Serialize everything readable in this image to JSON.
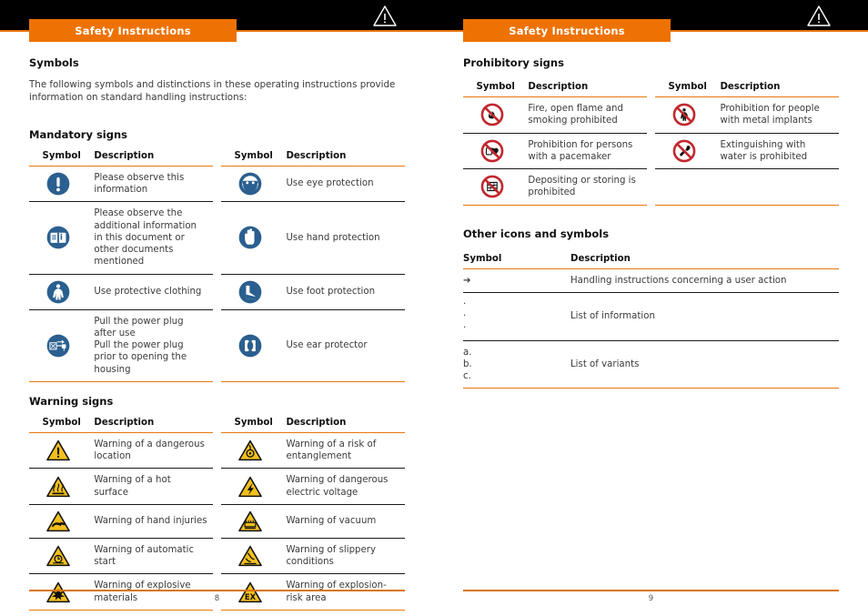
{
  "colors": {
    "accent_orange": "#ee7203",
    "rule_orange": "#e8760c",
    "header_black": "#000000",
    "mandatory_blue": "#2a5f8f",
    "warning_yellow": "#f2c01e",
    "prohibition_red": "#c1272d",
    "body_text": "#3b3b3b"
  },
  "left_page": {
    "header": {
      "tab_label": "Safety Instructions",
      "warning_icon": "warning-triangle-icon"
    },
    "symbols_heading": "Symbols",
    "intro_text": "The following symbols and distinctions in these operating instructions provide information on standard handling instructions:",
    "mandatory": {
      "heading": "Mandatory signs",
      "columns": [
        "Symbol",
        "Description",
        "Symbol",
        "Description"
      ],
      "rows": [
        {
          "left_icon": "mandatory-information-icon",
          "left_desc": "Please observe this information",
          "right_icon": "eye-protection-icon",
          "right_desc": "Use eye protection"
        },
        {
          "left_icon": "refer-to-manual-icon",
          "left_desc": "Please observe the additional information in this document or other documents mentioned",
          "right_icon": "hand-protection-icon",
          "right_desc": "Use hand protection"
        },
        {
          "left_icon": "protective-clothing-icon",
          "left_desc": "Use protective clothing",
          "right_icon": "foot-protection-icon",
          "right_desc": "Use foot protection"
        },
        {
          "left_icon": "disconnect-mains-plug-icon",
          "left_desc": "Pull the power plug after use\nPull the power plug prior to opening the housing",
          "right_icon": "ear-protection-icon",
          "right_desc": "Use ear protector"
        }
      ]
    },
    "warning": {
      "heading": "Warning signs",
      "columns": [
        "Symbol",
        "Description",
        "Symbol",
        "Description"
      ],
      "rows": [
        {
          "left_icon": "warning-general-hazard-icon",
          "left_desc": "Warning of a dangerous location",
          "right_icon": "warning-entanglement-icon",
          "right_desc": "Warning of a risk of entanglement"
        },
        {
          "left_icon": "warning-hot-surface-icon",
          "left_desc": "Warning of a hot surface",
          "right_icon": "warning-electric-voltage-icon",
          "right_desc": "Warning of dangerous electric voltage"
        },
        {
          "left_icon": "warning-hand-injury-icon",
          "left_desc": "Warning of hand injuries",
          "right_icon": "warning-vacuum-icon",
          "right_desc": "Warning of vacuum"
        },
        {
          "left_icon": "warning-automatic-start-icon",
          "left_desc": "Warning of automatic start",
          "right_icon": "warning-slippery-icon",
          "right_desc": "Warning of slippery conditions"
        },
        {
          "left_icon": "warning-explosive-materials-icon",
          "left_desc": "Warning of explosive materials",
          "right_icon": "warning-explosion-risk-area-icon",
          "right_desc": "Warning of explosion-risk area"
        }
      ]
    },
    "folio": "8"
  },
  "right_page": {
    "header": {
      "tab_label": "Safety Instructions",
      "warning_icon": "warning-triangle-icon"
    },
    "prohibitory": {
      "heading": "Prohibitory signs",
      "columns": [
        "Symbol",
        "Description",
        "Symbol",
        "Description"
      ],
      "rows": [
        {
          "left_icon": "no-fire-no-smoking-icon",
          "left_desc": "Fire, open flame and smoking prohibited",
          "right_icon": "no-metal-implants-icon",
          "right_desc": "Prohibition for people with metal implants"
        },
        {
          "left_icon": "no-pacemaker-icon",
          "left_desc": "Prohibition for persons with a pacemaker",
          "right_icon": "no-water-extinguishing-icon",
          "right_desc": "Extinguishing with water is prohibited"
        },
        {
          "left_icon": "no-depositing-storing-icon",
          "left_desc": "Depositing or storing is prohibited",
          "right_icon": "",
          "right_desc": ""
        }
      ]
    },
    "other": {
      "heading": "Other icons and symbols",
      "columns": [
        "Symbol",
        "Description"
      ],
      "rows": [
        {
          "symbol_kind": "arrow",
          "symbol_text": "➔",
          "desc": "Handling instructions concerning a user action"
        },
        {
          "symbol_kind": "bullets",
          "symbol_text": "·\n·\n·",
          "desc": "List of information"
        },
        {
          "symbol_kind": "letters",
          "symbol_text": "a.\nb.\nc.",
          "desc": "List of variants"
        }
      ]
    },
    "folio": "9"
  }
}
